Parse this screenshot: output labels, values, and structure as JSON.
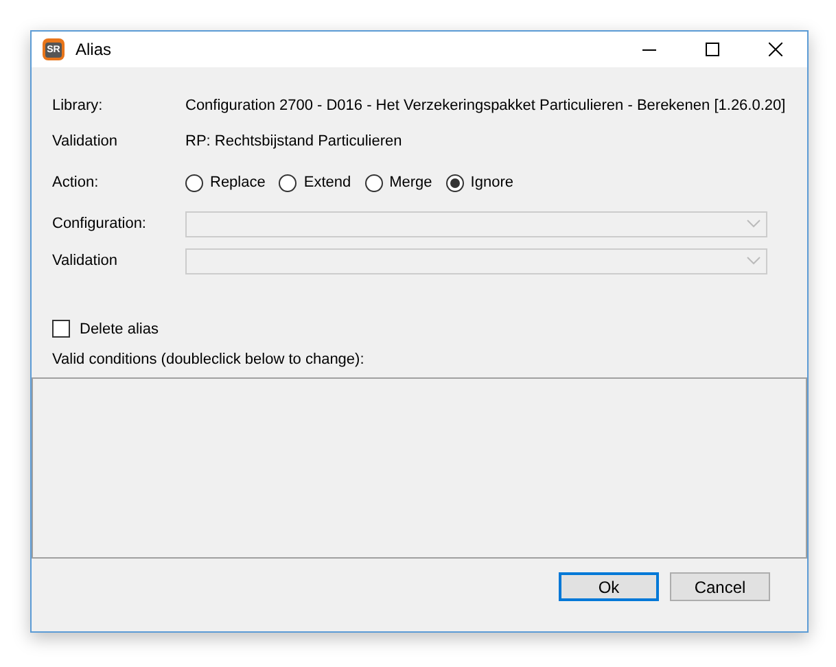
{
  "window": {
    "title": "Alias",
    "app_icon_text": "SR"
  },
  "info": [
    {
      "label": "Library:",
      "value": "Configuration 2700 - D016 - Het Verzekeringspakket Particulieren - Berekenen [1.26.0.20]"
    },
    {
      "label": "Validation",
      "value": "RP: Rechtsbijstand Particulieren"
    }
  ],
  "action": {
    "label": "Action:",
    "options": [
      {
        "label": "Replace",
        "selected": false
      },
      {
        "label": "Extend",
        "selected": false
      },
      {
        "label": "Merge",
        "selected": false
      },
      {
        "label": "Ignore",
        "selected": true
      }
    ]
  },
  "dropdowns": [
    {
      "label": "Configuration:",
      "disabled": true
    },
    {
      "label": "Validation",
      "disabled": true
    }
  ],
  "delete_alias": {
    "label": "Delete alias",
    "checked": false
  },
  "conditions": {
    "label": "Valid conditions (doubleclick below to change):"
  },
  "buttons": [
    {
      "label": "Ok",
      "default": true
    },
    {
      "label": "Cancel",
      "default": false
    }
  ]
}
